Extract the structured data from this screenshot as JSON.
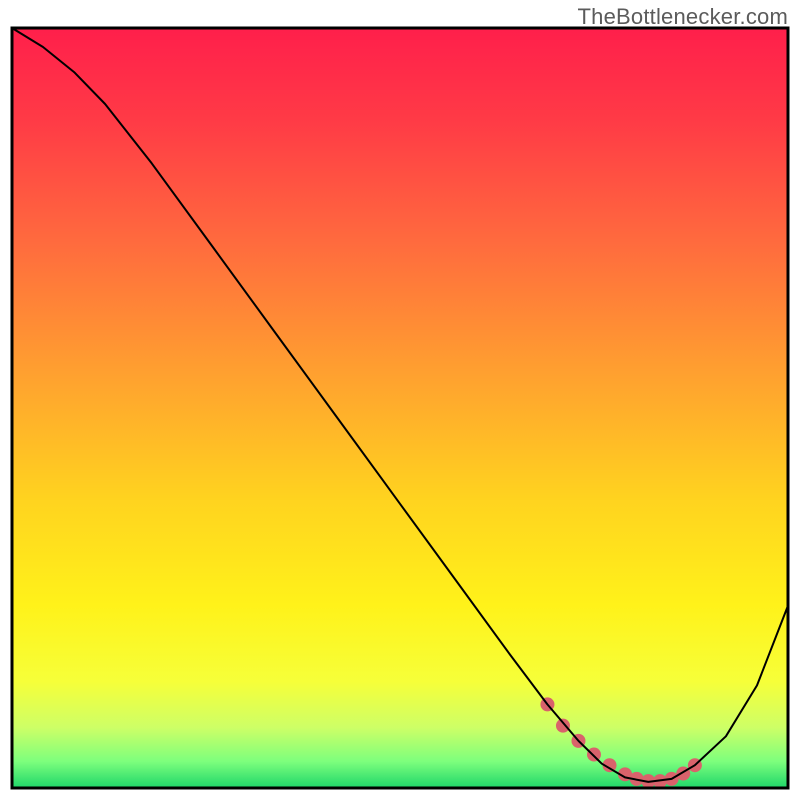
{
  "watermark": {
    "text": "TheBottlenecker.com"
  },
  "chart_data": {
    "type": "line",
    "title": "",
    "xlabel": "",
    "ylabel": "",
    "xlim": [
      0,
      100
    ],
    "ylim": [
      0,
      100
    ],
    "background_gradient_stops": [
      {
        "offset": 0.0,
        "color": "#ff1f4b"
      },
      {
        "offset": 0.12,
        "color": "#ff3a46"
      },
      {
        "offset": 0.28,
        "color": "#ff6a3e"
      },
      {
        "offset": 0.46,
        "color": "#ffa22f"
      },
      {
        "offset": 0.62,
        "color": "#ffd31f"
      },
      {
        "offset": 0.76,
        "color": "#fff21a"
      },
      {
        "offset": 0.86,
        "color": "#f6ff39"
      },
      {
        "offset": 0.92,
        "color": "#ceff66"
      },
      {
        "offset": 0.965,
        "color": "#7dff7d"
      },
      {
        "offset": 1.0,
        "color": "#1fd66a"
      }
    ],
    "series": [
      {
        "name": "curve",
        "color": "#000000",
        "width": 2,
        "x": [
          0,
          4,
          8,
          12,
          18,
          26,
          34,
          42,
          50,
          58,
          64,
          69,
          73,
          76,
          79,
          82,
          85,
          88,
          92,
          96,
          100
        ],
        "y": [
          100,
          97.5,
          94.2,
          90.0,
          82.2,
          71.0,
          59.8,
          48.6,
          37.4,
          26.2,
          17.8,
          11.0,
          6.2,
          3.2,
          1.4,
          0.8,
          1.2,
          3.0,
          6.8,
          13.5,
          24.0
        ]
      }
    ],
    "markers": {
      "name": "highlight-dots",
      "color": "#d9626b",
      "radius": 7,
      "x": [
        69.0,
        71.0,
        73.0,
        75.0,
        77.0,
        79.0,
        80.5,
        82.0,
        83.5,
        85.0,
        86.5,
        88.0
      ],
      "y": [
        11.0,
        8.2,
        6.2,
        4.4,
        3.0,
        1.8,
        1.2,
        0.9,
        0.9,
        1.2,
        1.9,
        3.0
      ]
    },
    "frame": {
      "stroke": "#000000",
      "width": 3,
      "inset_left": 12,
      "inset_right": 12,
      "inset_top": 28,
      "inset_bottom": 12
    }
  }
}
